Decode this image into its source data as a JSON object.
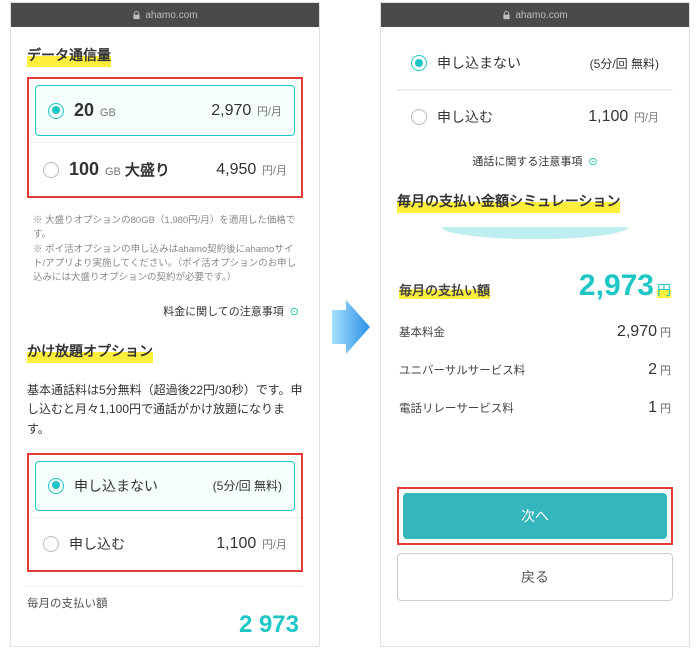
{
  "url": "ahamo.com",
  "left": {
    "data_title": "データ通信量",
    "plans": [
      {
        "amount": "20",
        "unit": "GB",
        "badge": "",
        "price": "2,970",
        "per": "円/月",
        "selected": true
      },
      {
        "amount": "100",
        "unit": "GB",
        "badge": "大盛り",
        "price": "4,950",
        "per": "円/月",
        "selected": false
      }
    ],
    "footnote": "※ 大盛りオプションの80GB（1,980円/月）を適用した価格です。\n※ ポイ活オプションの申し込みはahamo契約後にahamoサイト/アプリより実施してください。（ポイ活オプションのお申し込みには大盛りオプションの契約が必要です。）",
    "price_notice": "料金に関しての注意事項",
    "call_title": "かけ放題オプション",
    "call_desc": "基本通話料は5分無料（超過後22円/30秒）です。申し込むと月々1,100円で通話がかけ放題になります。",
    "call_opts": [
      {
        "label": "申し込まない",
        "right": "(5分/回 無料)",
        "selected": true
      },
      {
        "label": "申し込む",
        "right_num": "1,100",
        "right_unit": "円/月",
        "selected": false
      }
    ],
    "monthly_label": "毎月の支払い額",
    "monthly_peek": "2 973"
  },
  "right": {
    "call_opts": [
      {
        "label": "申し込まない",
        "right": "(5分/回 無料)",
        "selected": true
      },
      {
        "label": "申し込む",
        "right_num": "1,100",
        "right_unit": "円/月",
        "selected": false
      }
    ],
    "call_notice": "通話に関する注意事項",
    "sim_title": "毎月の支払い金額シミュレーション",
    "total_label": "毎月の支払い額",
    "total_value": "2,973",
    "total_unit": "円",
    "lines": [
      {
        "label": "基本料金",
        "value": "2,970",
        "unit": "円"
      },
      {
        "label": "ユニバーサルサービス料",
        "value": "2",
        "unit": "円"
      },
      {
        "label": "電話リレーサービス料",
        "value": "1",
        "unit": "円"
      }
    ],
    "next": "次へ",
    "back": "戻る"
  }
}
